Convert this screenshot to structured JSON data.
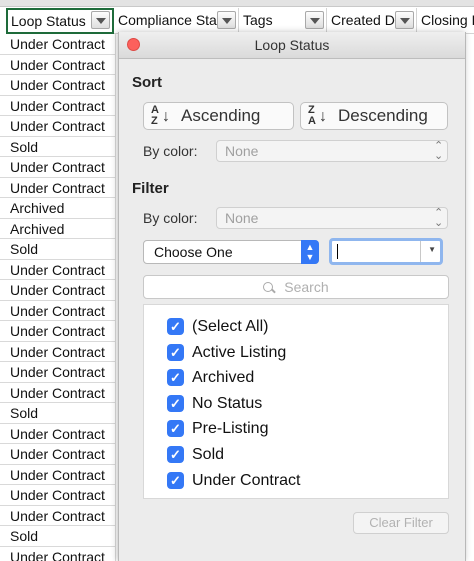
{
  "sheet": {
    "columns": [
      {
        "label": "Loop Status",
        "filter": true,
        "selected": true
      },
      {
        "label": "Compliance Statu",
        "filter": true,
        "selected": false
      },
      {
        "label": "Tags",
        "filter": true,
        "selected": false
      },
      {
        "label": "Created Da",
        "filter": true,
        "selected": false
      },
      {
        "label": "Closing De",
        "filter": false,
        "selected": false
      }
    ],
    "rows": [
      "Under Contract",
      "Under Contract",
      "Under Contract",
      "Under Contract",
      "Under Contract",
      "Sold",
      "Under Contract",
      "Under Contract",
      "Archived",
      "Archived",
      "Sold",
      "Under Contract",
      "Under Contract",
      "Under Contract",
      "Under Contract",
      "Under Contract",
      "Under Contract",
      "Under Contract",
      "Sold",
      "Under Contract",
      "Under Contract",
      "Under Contract",
      "Under Contract",
      "Under Contract",
      "Sold",
      "Under Contract"
    ],
    "grid_color": "#d9d9d9",
    "selected_border_color": "#1e6b3a"
  },
  "popup": {
    "title": "Loop Status",
    "sort": {
      "heading": "Sort",
      "ascending": {
        "label": "Ascending",
        "icon_top": "A",
        "icon_bottom": "Z"
      },
      "descending": {
        "label": "Descending",
        "icon_top": "Z",
        "icon_bottom": "A"
      },
      "by_color_label": "By color:",
      "by_color_value": "None"
    },
    "filter": {
      "heading": "Filter",
      "by_color_label": "By color:",
      "by_color_value": "None",
      "condition_value": "Choose One",
      "condition_input_value": "",
      "search_placeholder": "Search",
      "items": [
        {
          "label": "(Select All)",
          "checked": true
        },
        {
          "label": "Active Listing",
          "checked": true
        },
        {
          "label": "Archived",
          "checked": true
        },
        {
          "label": "No Status",
          "checked": true
        },
        {
          "label": "Pre-Listing",
          "checked": true
        },
        {
          "label": "Sold",
          "checked": true
        },
        {
          "label": "Under Contract",
          "checked": true
        }
      ],
      "clear_label": "Clear Filter"
    },
    "accent_color": "#3478f6",
    "close_color": "#fc605c"
  }
}
